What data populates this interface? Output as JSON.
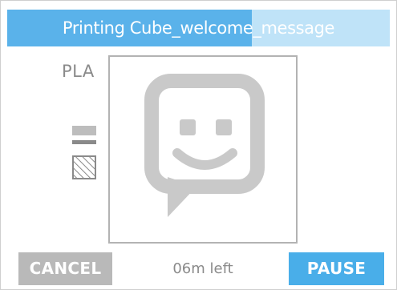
{
  "header": {
    "title": "Printing Cube_welcome_message",
    "progress_fraction": 0.64,
    "progress_color": "#5ab2ea",
    "track_color": "#bfe3f8"
  },
  "material": {
    "label": "PLA",
    "icon": "filament-spool-icon"
  },
  "preview": {
    "icon": "chat-smiley-icon"
  },
  "footer": {
    "cancel_label": "CANCEL",
    "time_left": "06m left",
    "pause_label": "PAUSE",
    "cancel_color": "#b9b9b9",
    "pause_color": "#49aee9"
  }
}
